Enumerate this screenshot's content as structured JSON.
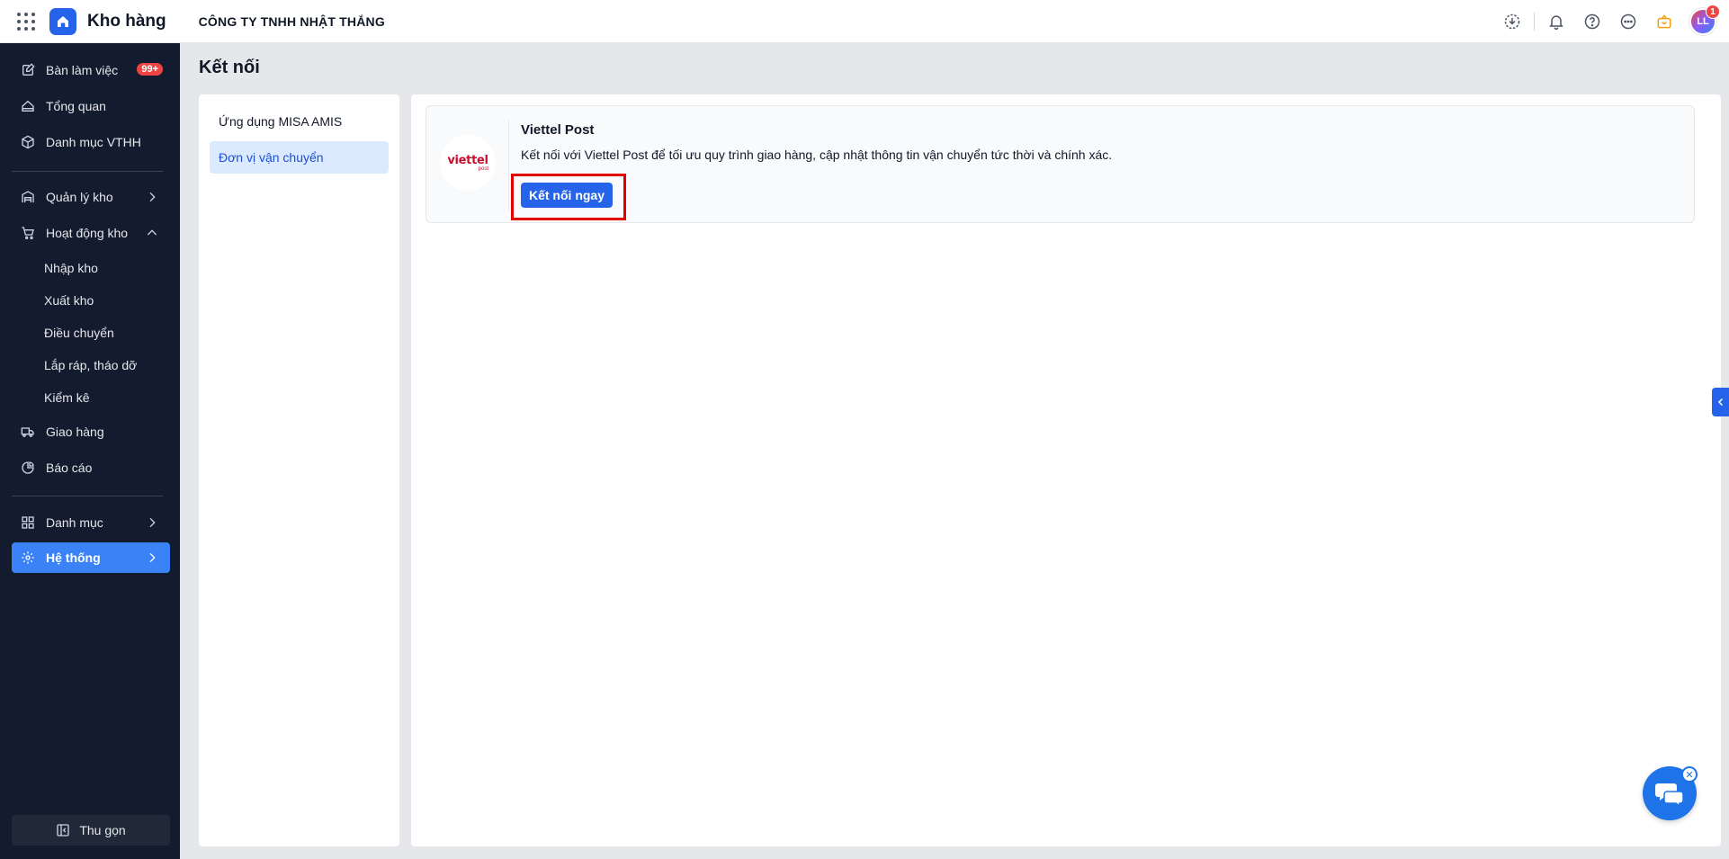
{
  "topbar": {
    "app_title": "Kho hàng",
    "company_name": "CÔNG TY TNHH NHẬT THẮNG",
    "avatar_initials": "LL",
    "notification_count": "1"
  },
  "sidebar": {
    "items": {
      "workspace": {
        "label": "Bàn làm việc",
        "badge": "99+"
      },
      "overview": {
        "label": "Tổng quan"
      },
      "catalog_vthh": {
        "label": "Danh mục VTHH"
      },
      "warehouse_mgmt": {
        "label": "Quản lý kho"
      },
      "warehouse_ops": {
        "label": "Hoạt động kho"
      },
      "delivery": {
        "label": "Giao hàng"
      },
      "reports": {
        "label": "Báo cáo"
      },
      "categories": {
        "label": "Danh mục"
      },
      "system": {
        "label": "Hệ thống"
      }
    },
    "sub_items": [
      "Nhập kho",
      "Xuất kho",
      "Điều chuyển",
      "Lắp ráp, tháo dỡ",
      "Kiểm kê"
    ],
    "collapse_label": "Thu gọn"
  },
  "main": {
    "page_title": "Kết nối",
    "left_menu": [
      "Ứng dụng MISA AMIS",
      "Đơn vị vận chuyển"
    ],
    "card": {
      "logo_text": "viettel",
      "logo_subtext": "post",
      "title": "Viettel Post",
      "description": "Kết nối với Viettel Post để tối ưu quy trình giao hàng, cập nhật thông tin vận chuyển tức thời và chính xác.",
      "button_label": "Kết nối ngay"
    }
  },
  "colors": {
    "sidebar_bg": "#131b2e",
    "accent": "#3b82f6",
    "primary_button": "#2563eb",
    "highlight_border": "#e00000",
    "brand_viettel": "#c8102e"
  }
}
